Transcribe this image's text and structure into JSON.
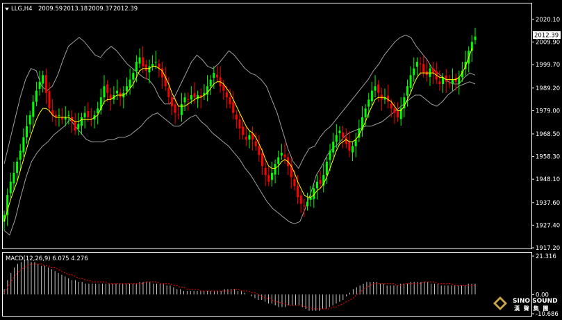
{
  "header": {
    "symbol": "LLG,H4",
    "ohlc": [
      "2009.59",
      "2013.18",
      "2009.37",
      "2012.39"
    ]
  },
  "logo": {
    "text": "SINO SOUND",
    "chinese": "漢 聲 集 團"
  },
  "colors": {
    "background": "#000000",
    "up_candle": "#00ff00",
    "down_candle": "#ff0000",
    "ma_line": "#ffff00",
    "bollinger": "#a0a0a0",
    "macd_hist": "#c8c8c8",
    "macd_signal": "#ff0000",
    "frame": "#ffffff"
  },
  "chart_data": [
    {
      "type": "candlestick",
      "title": "LLG,H4",
      "ylim": [
        1917.2,
        2024.5
      ],
      "y_ticks": [
        "2020.10",
        "2009.90",
        "1999.70",
        "1989.20",
        "1979.00",
        "1968.50",
        "1958.30",
        "1948.10",
        "1937.60",
        "1927.40",
        "1917.20"
      ],
      "current_price": "2012.39",
      "close_series": [
        1932,
        1941,
        1947,
        1951,
        1956,
        1961,
        1967,
        1972,
        1977,
        1983,
        1988,
        1992,
        1995,
        1987,
        1980,
        1977,
        1976,
        1977,
        1975,
        1976,
        1977,
        1974,
        1970,
        1973,
        1976,
        1978,
        1976,
        1975,
        1977,
        1980,
        1985,
        1990,
        1987,
        1984,
        1986,
        1988,
        1985,
        1987,
        1990,
        1993,
        1996,
        2001,
        2003,
        1999,
        1997,
        1999,
        2000,
        2001,
        1998,
        1994,
        1990,
        1985,
        1981,
        1978,
        1977,
        1982,
        1985,
        1984,
        1986,
        1985,
        1986,
        1985,
        1987,
        1990,
        1993,
        1996,
        1994,
        1990,
        1988,
        1985,
        1982,
        1978,
        1975,
        1971,
        1968,
        1966,
        1968,
        1966,
        1963,
        1959,
        1954,
        1950,
        1947,
        1951,
        1955,
        1958,
        1960,
        1958,
        1954,
        1949,
        1945,
        1940,
        1937,
        1936,
        1938,
        1940,
        1944,
        1947,
        1946,
        1950,
        1956,
        1961,
        1965,
        1968,
        1970,
        1967,
        1964,
        1961,
        1963,
        1966,
        1971,
        1976,
        1980,
        1984,
        1988,
        1990,
        1987,
        1984,
        1985,
        1983,
        1980,
        1978,
        1976,
        1980,
        1985,
        1990,
        1995,
        1998,
        2001,
        2000,
        1996,
        1995,
        1998,
        1996,
        1993,
        1991,
        1994,
        1992,
        1991,
        1993,
        1992,
        1994,
        1997,
        2001,
        2006,
        2010,
        2012.39
      ],
      "ma_series": [
        1929,
        1934,
        1939,
        1943,
        1947,
        1952,
        1957,
        1962,
        1967,
        1971,
        1975,
        1978,
        1980,
        1980,
        1979,
        1977,
        1976,
        1976,
        1976,
        1976,
        1976,
        1975,
        1974,
        1974,
        1975,
        1975,
        1975,
        1975,
        1976,
        1977,
        1980,
        1983,
        1984,
        1984,
        1985,
        1986,
        1986,
        1986,
        1987,
        1989,
        1991,
        1994,
        1997,
        1998,
        1998,
        1998,
        1999,
        1999,
        1998,
        1997,
        1994,
        1991,
        1987,
        1984,
        1981,
        1981,
        1981,
        1982,
        1983,
        1984,
        1985,
        1985,
        1986,
        1987,
        1989,
        1991,
        1992,
        1992,
        1991,
        1989,
        1987,
        1984,
        1981,
        1978,
        1975,
        1972,
        1970,
        1969,
        1967,
        1964,
        1961,
        1957,
        1954,
        1953,
        1953,
        1954,
        1956,
        1957,
        1956,
        1954,
        1951,
        1947,
        1944,
        1941,
        1940,
        1940,
        1941,
        1943,
        1944,
        1946,
        1949,
        1953,
        1957,
        1961,
        1964,
        1965,
        1966,
        1965,
        1965,
        1966,
        1968,
        1971,
        1974,
        1978,
        1981,
        1984,
        1985,
        1985,
        1985,
        1984,
        1983,
        1981,
        1979,
        1979,
        1981,
        1984,
        1987,
        1991,
        1994,
        1996,
        1996,
        1996,
        1996,
        1996,
        1995,
        1994,
        1994,
        1993,
        1993,
        1993,
        1993,
        1994,
        1996,
        1999,
        2003,
        2007
      ],
      "upper_band": [
        1955,
        1965,
        1975,
        1985,
        1993,
        1998,
        1997,
        1990,
        1988,
        1990,
        1995,
        2002,
        2008,
        2010,
        2012,
        2010,
        2007,
        2004,
        2003,
        2006,
        2008,
        2006,
        2003,
        2000,
        1998,
        1996,
        1994,
        1993,
        1990,
        1985,
        1982,
        1982,
        1986,
        1991,
        1996,
        2001,
        2004,
        2002,
        1999,
        1998,
        2000,
        2003,
        2006,
        2004,
        2001,
        1998,
        1996,
        1995,
        1993,
        1990,
        1984,
        1978,
        1970,
        1962,
        1956,
        1953,
        1958,
        1962,
        1963,
        1967,
        1970,
        1972,
        1975,
        1978,
        1981,
        1984,
        1987,
        1990,
        1993,
        1997,
        2000,
        2004,
        2007,
        2010,
        2012,
        2013,
        2012,
        2008,
        2005,
        2002,
        1998,
        1996,
        1994,
        1992,
        1991,
        1991,
        1994,
        1996,
        1995
      ],
      "lower_band": [
        1925,
        1923,
        1930,
        1940,
        1949,
        1956,
        1960,
        1963,
        1965,
        1968,
        1970,
        1972,
        1975,
        1972,
        1969,
        1966,
        1965,
        1965,
        1965,
        1966,
        1966,
        1967,
        1967,
        1968,
        1970,
        1972,
        1975,
        1977,
        1978,
        1976,
        1974,
        1972,
        1972,
        1974,
        1976,
        1977,
        1974,
        1972,
        1969,
        1967,
        1965,
        1963,
        1960,
        1957,
        1953,
        1950,
        1946,
        1942,
        1938,
        1935,
        1933,
        1931,
        1929,
        1928,
        1929,
        1935,
        1942,
        1950,
        1954,
        1959,
        1962,
        1964,
        1967,
        1969,
        1970,
        1971,
        1972,
        1972,
        1973,
        1974,
        1976,
        1978,
        1980,
        1982,
        1984,
        1986,
        1986,
        1984,
        1982,
        1981,
        1983,
        1986,
        1988,
        1990,
        1991,
        1992,
        1991
      ]
    },
    {
      "type": "bar",
      "title": "MACD(12,26,9) 6.075 4.276",
      "ylim": [
        -10.686,
        21.316
      ],
      "y_ticks": [
        "21.316",
        "0.00",
        "-10.686"
      ],
      "macd_values": [
        3,
        8,
        12,
        15,
        17,
        18,
        19,
        19,
        18,
        18,
        17,
        16,
        16,
        15,
        14,
        13,
        12,
        11,
        10,
        9,
        8,
        8,
        7,
        7,
        6,
        6,
        6,
        6,
        6,
        6,
        6,
        6,
        6,
        6,
        6,
        6,
        6,
        6,
        6,
        6,
        7,
        7,
        7,
        7,
        6,
        6,
        6,
        6,
        5,
        5,
        4,
        3,
        3,
        2,
        2,
        2,
        2,
        2,
        2,
        2,
        2,
        2,
        2,
        2,
        2,
        3,
        3,
        3,
        3,
        2,
        2,
        1,
        0,
        -1,
        -2,
        -3,
        -3,
        -4,
        -5,
        -5,
        -6,
        -7,
        -7,
        -7,
        -6,
        -6,
        -6,
        -6,
        -7,
        -8,
        -9,
        -9,
        -9,
        -9,
        -8,
        -8,
        -7,
        -6,
        -5,
        -4,
        -3,
        -1,
        1,
        3,
        4,
        5,
        6,
        7,
        7,
        7,
        7,
        6,
        6,
        5,
        5,
        5,
        5,
        6,
        6,
        6,
        7,
        7,
        7,
        7,
        7,
        7,
        6,
        6,
        6,
        5,
        5,
        5,
        5,
        5,
        5,
        5,
        5,
        6,
        6,
        6
      ],
      "signal_values": [
        1,
        4,
        7,
        10,
        12,
        14,
        15,
        16,
        17,
        17,
        17,
        17,
        16,
        16,
        15,
        15,
        14,
        13,
        12,
        11,
        11,
        10,
        9,
        9,
        8,
        8,
        7,
        7,
        7,
        7,
        7,
        6,
        6,
        6,
        6,
        6,
        6,
        6,
        6,
        6,
        6,
        6,
        7,
        7,
        7,
        7,
        6,
        6,
        6,
        6,
        5,
        5,
        4,
        4,
        3,
        3,
        3,
        3,
        2,
        2,
        2,
        2,
        2,
        2,
        2,
        2,
        2,
        2,
        3,
        3,
        2,
        2,
        2,
        1,
        1,
        0,
        -1,
        -2,
        -2,
        -3,
        -4,
        -4,
        -5,
        -5,
        -6,
        -6,
        -6,
        -6,
        -6,
        -7,
        -7,
        -8,
        -8,
        -8,
        -8,
        -8,
        -8,
        -7,
        -7,
        -6,
        -5,
        -4,
        -3,
        -2,
        0,
        1,
        3,
        4,
        5,
        6,
        6,
        6,
        6,
        6,
        6,
        6,
        5,
        5,
        6,
        6,
        6,
        6,
        6,
        6,
        7,
        7,
        7,
        7,
        6,
        6,
        6,
        6,
        6,
        5,
        5,
        5,
        5,
        5,
        5,
        5
      ]
    }
  ]
}
